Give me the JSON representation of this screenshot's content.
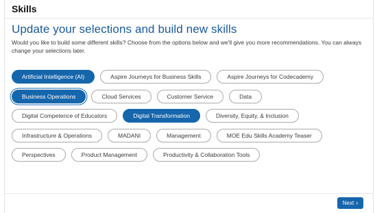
{
  "header": {
    "title": "Skills"
  },
  "main": {
    "subtitle": "Update your selections and build new skills",
    "description": "Would you like to build some different skills? Choose from the options below and we'll give you more recommendations. You can always change your selections later."
  },
  "chips": [
    [
      {
        "label": "Artificial Intelligence (AI)",
        "selected": true
      },
      {
        "label": "Aspire Journeys for Business Skills",
        "selected": false
      },
      {
        "label": "Aspire Journeys for Codecademy",
        "selected": false
      }
    ],
    [
      {
        "label": "Business Operations",
        "selected": true
      },
      {
        "label": "Cloud Services",
        "selected": false
      },
      {
        "label": "Customer Service",
        "selected": false
      },
      {
        "label": "Data",
        "selected": false
      }
    ],
    [
      {
        "label": "Digital Competence of Educators",
        "selected": false
      },
      {
        "label": "Digital Transformation",
        "selected": true
      },
      {
        "label": "Diversity, Equity, & Inclusion",
        "selected": false
      }
    ],
    [
      {
        "label": "Infrastructure & Operations",
        "selected": false
      },
      {
        "label": "MADANI",
        "selected": false
      },
      {
        "label": "Management",
        "selected": false
      },
      {
        "label": "MOE Edu Skills Academy Teaser",
        "selected": false
      }
    ],
    [
      {
        "label": "Perspectives",
        "selected": false
      },
      {
        "label": "Product Management",
        "selected": false
      },
      {
        "label": "Productivity & Collaboration Tools",
        "selected": false
      }
    ]
  ],
  "footer": {
    "next_label": "Next",
    "next_icon": "chevron-right-icon"
  },
  "colors": {
    "accent": "#1666ac",
    "subtitle": "#1a5aa0"
  }
}
